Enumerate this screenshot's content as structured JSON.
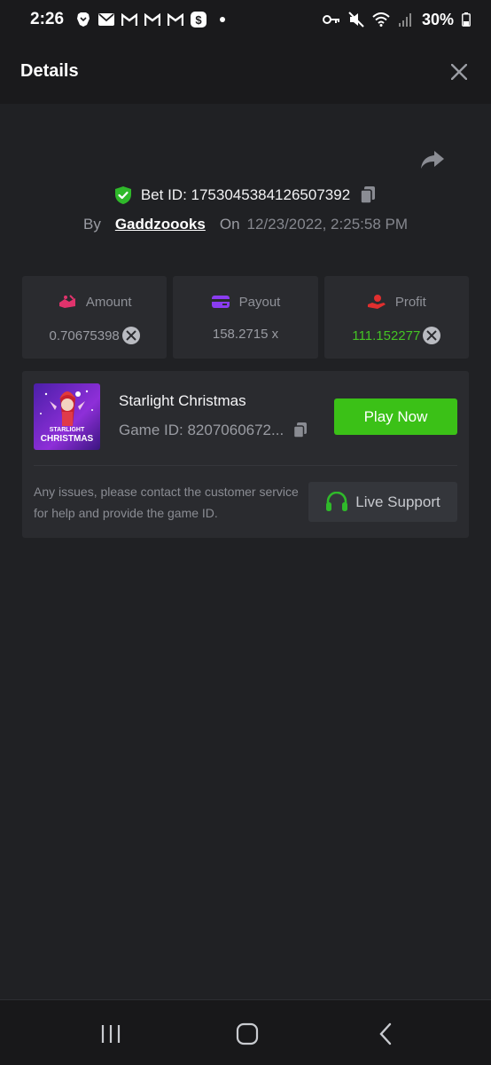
{
  "status_bar": {
    "time": "2:26",
    "battery": "30%",
    "left_icons": [
      "brave-icon",
      "mail-icon",
      "gmail-icon",
      "gmail-icon",
      "gmail-icon",
      "cash-app-icon"
    ],
    "right_icons": [
      "key-icon",
      "mute-icon",
      "wifi-icon",
      "signal-icon",
      "battery-icon"
    ]
  },
  "header": {
    "title": "Details"
  },
  "bet": {
    "bet_id_label": "Bet ID: 1753045384126507392",
    "by_label": "By",
    "username": "Gaddzoooks",
    "on_label": "On",
    "date": "12/23/2022, 2:25:58 PM"
  },
  "stats": {
    "amount": {
      "label": "Amount",
      "value": "0.70675398"
    },
    "payout": {
      "label": "Payout",
      "value": "158.2715 x"
    },
    "profit": {
      "label": "Profit",
      "value": "111.152277"
    }
  },
  "game": {
    "name": "Starlight Christmas",
    "game_id": "Game ID: 8207060672...",
    "play_label": "Play Now",
    "thumb_text_1": "STARLIGHT",
    "thumb_text_2": "CHRISTMAS",
    "help_text": "Any issues, please contact the customer service for help and provide the game ID.",
    "support_label": "Live Support"
  },
  "colors": {
    "accent_green": "#3bc117",
    "profit_green": "#44c424",
    "amount_pink": "#e0336c",
    "payout_purple": "#8a3cf0",
    "profit_red": "#e02f2f",
    "verified_green": "#2fb92a"
  }
}
